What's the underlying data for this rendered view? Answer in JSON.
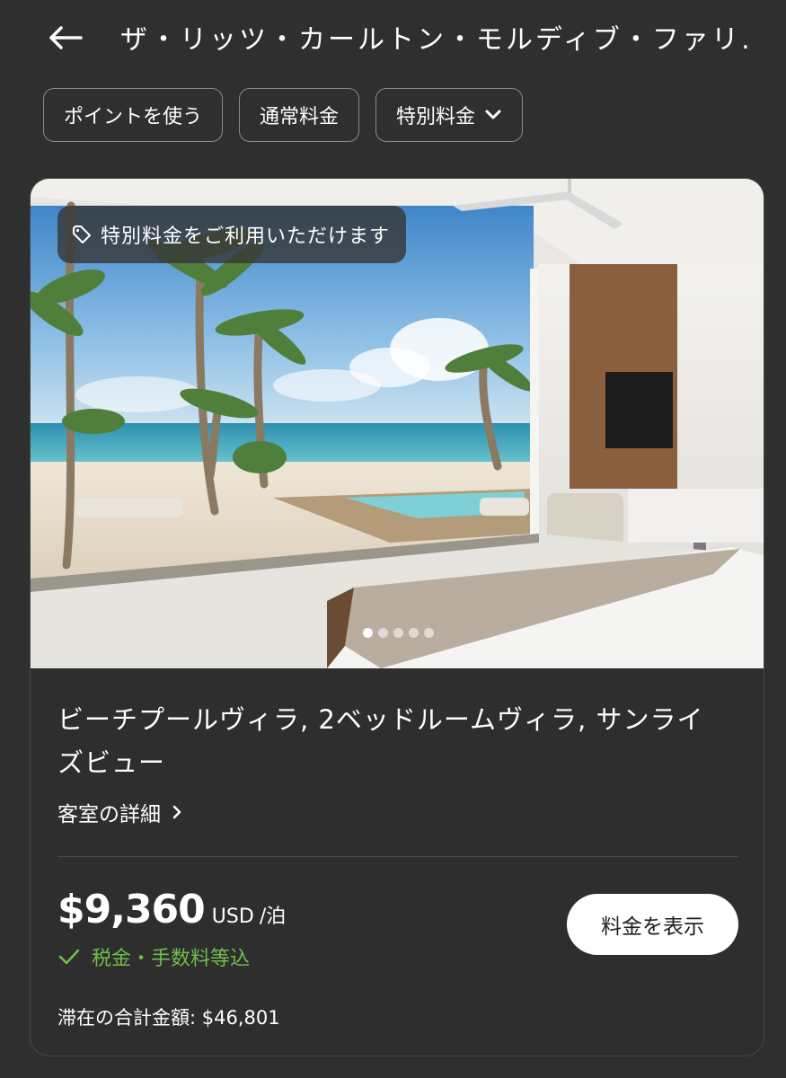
{
  "header": {
    "title": "ザ・リッツ・カールトン・モルディブ・ファリ…"
  },
  "filters": {
    "chips": [
      {
        "label": "ポイントを使う"
      },
      {
        "label": "通常料金"
      },
      {
        "label": "特別料金"
      }
    ]
  },
  "room": {
    "badge": "特別料金をご利用いただけます",
    "name": "ビーチプールヴィラ, 2ベッドルームヴィラ, サンライズビュー",
    "details_link": "客室の詳細",
    "carousel": {
      "count": 5,
      "active": 1
    },
    "price": {
      "amount": "$9,360",
      "currency": "USD",
      "unit": "/泊"
    },
    "tax_note": "税金・手数料等込",
    "total": "滞在の合計金額: $46,801",
    "cta": "料金を表示"
  },
  "colors": {
    "background": "#2f2f2f",
    "accent_green": "#6fbf4a",
    "button_bg": "#ffffff"
  },
  "icons": [
    "back-arrow-icon",
    "chevron-down-icon",
    "tag-icon",
    "chevron-right-icon",
    "check-icon"
  ]
}
